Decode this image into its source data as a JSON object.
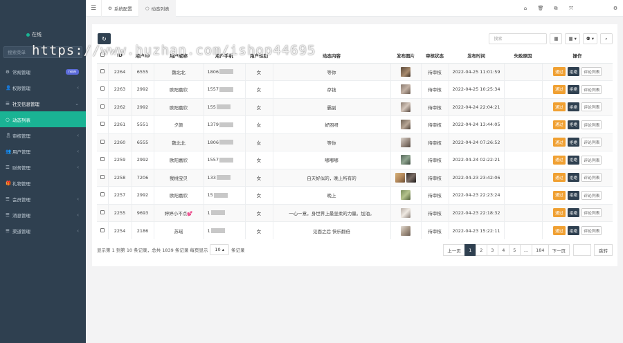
{
  "sidebar": {
    "status": "在线",
    "search_placeholder": "搜索菜单",
    "items": [
      {
        "icon": "cogs-icon",
        "glyph": "⚙",
        "label": "常规管理",
        "badge": "new",
        "arrow": ""
      },
      {
        "icon": "user-icon",
        "glyph": "👤",
        "label": "权限管理",
        "badge": "",
        "arrow": "‹"
      },
      {
        "icon": "list-icon",
        "glyph": "☰",
        "label": "社交信息管理",
        "badge": "",
        "arrow": "⌄"
      },
      {
        "icon": "circle-icon",
        "glyph": "○",
        "label": "动态列表",
        "badge": "",
        "arrow": ""
      },
      {
        "icon": "ribbon-icon",
        "glyph": "🎗",
        "label": "审核管理",
        "badge": "",
        "arrow": "‹"
      },
      {
        "icon": "users-icon",
        "glyph": "👥",
        "label": "用户管理",
        "badge": "",
        "arrow": "‹"
      },
      {
        "icon": "list-icon",
        "glyph": "☰",
        "label": "财务管理",
        "badge": "",
        "arrow": "‹"
      },
      {
        "icon": "gift-icon",
        "glyph": "🎁",
        "label": "礼物管理",
        "badge": "",
        "arrow": ""
      },
      {
        "icon": "list-icon",
        "glyph": "☰",
        "label": "会员管理",
        "badge": "",
        "arrow": "‹"
      },
      {
        "icon": "list-icon",
        "glyph": "☰",
        "label": "消息管理",
        "badge": "",
        "arrow": "‹"
      },
      {
        "icon": "list-icon",
        "glyph": "☰",
        "label": "渠道管理",
        "badge": "",
        "arrow": "‹"
      }
    ]
  },
  "topbar": {
    "tabs": [
      {
        "icon": "gear-icon",
        "glyph": "⚙",
        "label": "系统配置"
      },
      {
        "icon": "circle-icon",
        "glyph": "○",
        "label": "动态列表"
      }
    ]
  },
  "toolbar": {
    "search_placeholder": "搜索"
  },
  "table": {
    "headers": [
      "",
      "ID",
      "用户ID",
      "用户昵称",
      "用户手机",
      "用户性别",
      "动态内容",
      "发布图片",
      "审核状态",
      "发布时间",
      "失败原因",
      "操作"
    ],
    "rows": [
      {
        "id": "2264",
        "uid": "6555",
        "nick": "魏北北",
        "phone": "1806",
        "sex": "女",
        "content": "等你",
        "pics": [
          "p1"
        ],
        "status": "待审核",
        "time": "2022-04-25 11:01:59",
        "reason": ""
      },
      {
        "id": "2263",
        "uid": "2992",
        "nick": "欧阳嘉欣",
        "phone": "1557",
        "sex": "女",
        "content": "存钱",
        "pics": [
          "p2"
        ],
        "status": "待审核",
        "time": "2022-04-25 10:25:34",
        "reason": ""
      },
      {
        "id": "2262",
        "uid": "2992",
        "nick": "欧阳嘉欣",
        "phone": "155",
        "sex": "女",
        "content": "霸副",
        "pics": [
          "p3"
        ],
        "status": "待审核",
        "time": "2022-04-24 22:04:21",
        "reason": ""
      },
      {
        "id": "2261",
        "uid": "5551",
        "nick": "夕颜",
        "phone": "1379",
        "sex": "女",
        "content": "好困呀",
        "pics": [
          "p4"
        ],
        "status": "待审核",
        "time": "2022-04-24 13:44:05",
        "reason": ""
      },
      {
        "id": "2260",
        "uid": "6555",
        "nick": "魏北北",
        "phone": "1806",
        "sex": "女",
        "content": "等你",
        "pics": [
          "p5"
        ],
        "status": "待审核",
        "time": "2022-04-24 07:26:52",
        "reason": ""
      },
      {
        "id": "2259",
        "uid": "2992",
        "nick": "欧阳嘉欣",
        "phone": "1557",
        "sex": "女",
        "content": "嘟嘟嘟",
        "pics": [
          "p6"
        ],
        "status": "待审核",
        "time": "2022-04-24 02:22:21",
        "reason": ""
      },
      {
        "id": "2258",
        "uid": "7206",
        "nick": "我桃宝贝",
        "phone": "133",
        "sex": "女",
        "content": "白天好似的，晚上所有的",
        "pics": [
          "p7",
          "p8"
        ],
        "status": "待审核",
        "time": "2022-04-23 23:42:06",
        "reason": ""
      },
      {
        "id": "2257",
        "uid": "2992",
        "nick": "欧阳嘉欣",
        "phone": "15",
        "sex": "女",
        "content": "晚上",
        "pics": [
          "p9"
        ],
        "status": "待审核",
        "time": "2022-04-23 22:23:24",
        "reason": ""
      },
      {
        "id": "2255",
        "uid": "9693",
        "nick": "婷婷小不点💕",
        "phone": "1",
        "sex": "女",
        "content": "一心一意，身世界上最坚柔的力量。加油。",
        "pics": [
          "p10"
        ],
        "status": "待审核",
        "time": "2022-04-23 22:18:32",
        "reason": ""
      },
      {
        "id": "2254",
        "uid": "2186",
        "nick": "苏瑶",
        "phone": "1",
        "sex": "女",
        "content": "见面之后 快乐翻倍",
        "pics": [
          "p11"
        ],
        "status": "待审核",
        "time": "2022-04-23 15:22:11",
        "reason": ""
      }
    ],
    "actions": {
      "pass": "通过",
      "reject": "拒绝",
      "comments": "评论列表"
    }
  },
  "footer": {
    "summary": "显示第 1 到第 10 条记录，总共 1839 条记录 每页显示",
    "page_size": "10",
    "suffix": "条记录"
  },
  "pager": {
    "prev": "上一页",
    "pages": [
      "1",
      "2",
      "3",
      "4",
      "5",
      "...",
      "184"
    ],
    "next": "下一页",
    "go": "跳转"
  },
  "watermark": "https://www.huzhan.com/ishop44695"
}
